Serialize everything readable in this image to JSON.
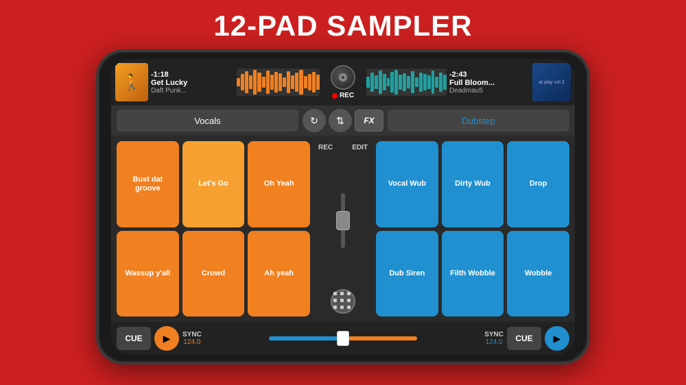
{
  "title": "12-PAD SAMPLER",
  "left_track": {
    "timer": "-1:18",
    "name": "Get Lucky",
    "artist": "Daft Punk...",
    "art_emoji": "🚶"
  },
  "right_track": {
    "timer": "-2:43",
    "name": "Full Bloom...",
    "artist": "Deadmau5",
    "art_label": "at play vol.3"
  },
  "rec_label": "REC",
  "controls": {
    "left_category": "Vocals",
    "right_category": "Dubstep",
    "fx_label": "FX"
  },
  "left_pads": [
    {
      "label": "Bust dat groove",
      "color": "orange"
    },
    {
      "label": "Let's Go",
      "color": "orange-bright"
    },
    {
      "label": "Oh Yeah",
      "color": "orange"
    },
    {
      "label": "Wassup y'all",
      "color": "orange"
    },
    {
      "label": "Crowd",
      "color": "orange"
    },
    {
      "label": "Ah yeah",
      "color": "orange"
    }
  ],
  "right_pads": [
    {
      "label": "Vocal Wub",
      "color": "blue"
    },
    {
      "label": "Dirty Wub",
      "color": "blue"
    },
    {
      "label": "Drop",
      "color": "blue"
    },
    {
      "label": "Dub Siren",
      "color": "blue"
    },
    {
      "label": "Filth Wobble",
      "color": "blue"
    },
    {
      "label": "Wobble",
      "color": "blue"
    }
  ],
  "center": {
    "rec_label": "REC",
    "edit_label": "EDIT"
  },
  "bottom": {
    "left_cue": "CUE",
    "left_sync": "SYNC",
    "left_bpm": "124.0",
    "right_sync": "SYNC",
    "right_bpm": "124.0",
    "right_cue": "CUE"
  }
}
